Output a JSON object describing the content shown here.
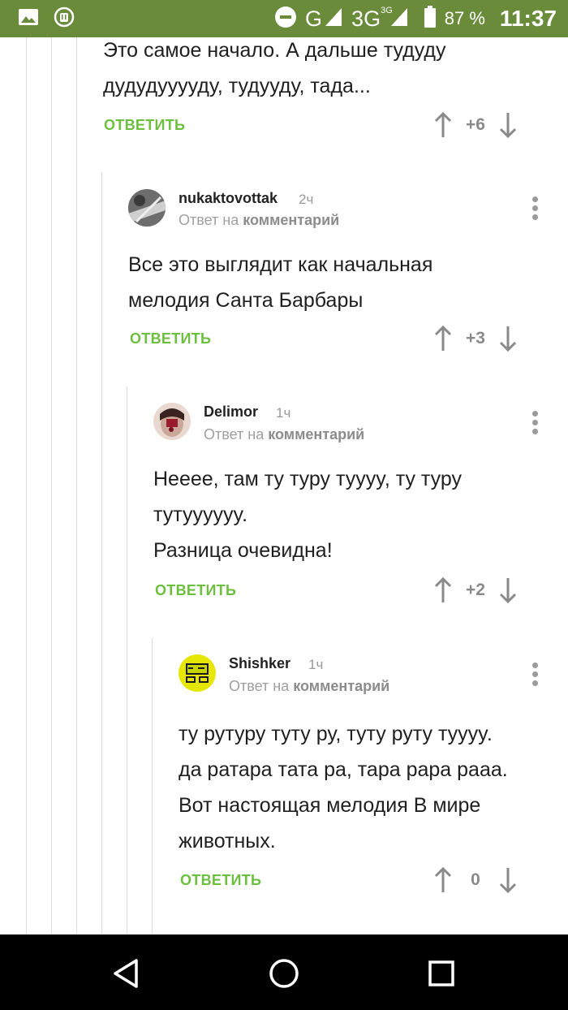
{
  "status_bar": {
    "network_g": "G",
    "network_3g": "3G",
    "network_3g_sup": "3G",
    "battery": "87 %",
    "time": "11:37",
    "icons": [
      "gallery-icon",
      "android-icon",
      "dnd-icon",
      "signal-icon",
      "battery-icon"
    ]
  },
  "colors": {
    "status_bar": "#6a8b3a",
    "reply_link": "#6cbf3f",
    "nav_bar": "#000000"
  },
  "comments": [
    {
      "text": [
        "Это самое начало. А дальше тудуду",
        "дудудууууду, тудууду, тада..."
      ],
      "reply_label": "ОТВЕТИТЬ",
      "score": "+6"
    },
    {
      "username": "nukaktovottak",
      "time": "2ч",
      "reply_prefix": "Ответ на",
      "reply_target": "комментарий",
      "text": [
        "Все это выглядит как начальная",
        "мелодия Санта Барбары"
      ],
      "reply_label": "ОТВЕТИТЬ",
      "score": "+3"
    },
    {
      "username": "Delimor",
      "time": "1ч",
      "reply_prefix": "Ответ на",
      "reply_target": "комментарий",
      "text": [
        "Неееe, там ту туру тууyy, ту туру",
        "тутууууyy.",
        "Разница очевидна!"
      ],
      "reply_label": "ОТВЕТИТЬ",
      "score": "+2"
    },
    {
      "username": "Shishker",
      "time": "1ч",
      "reply_prefix": "Ответ на",
      "reply_target": "комментарий",
      "text": [
        "ту рутуру туту ру, туту руту тууyy.",
        "да ратара тата ра, тара рара рааа.",
        "Вот настоящая мелодия В мире",
        "животных."
      ],
      "reply_label": "ОТВЕТИТЬ",
      "score": "0"
    }
  ],
  "nav_bar": {
    "icons": [
      "back-icon",
      "home-icon",
      "recents-icon"
    ]
  }
}
